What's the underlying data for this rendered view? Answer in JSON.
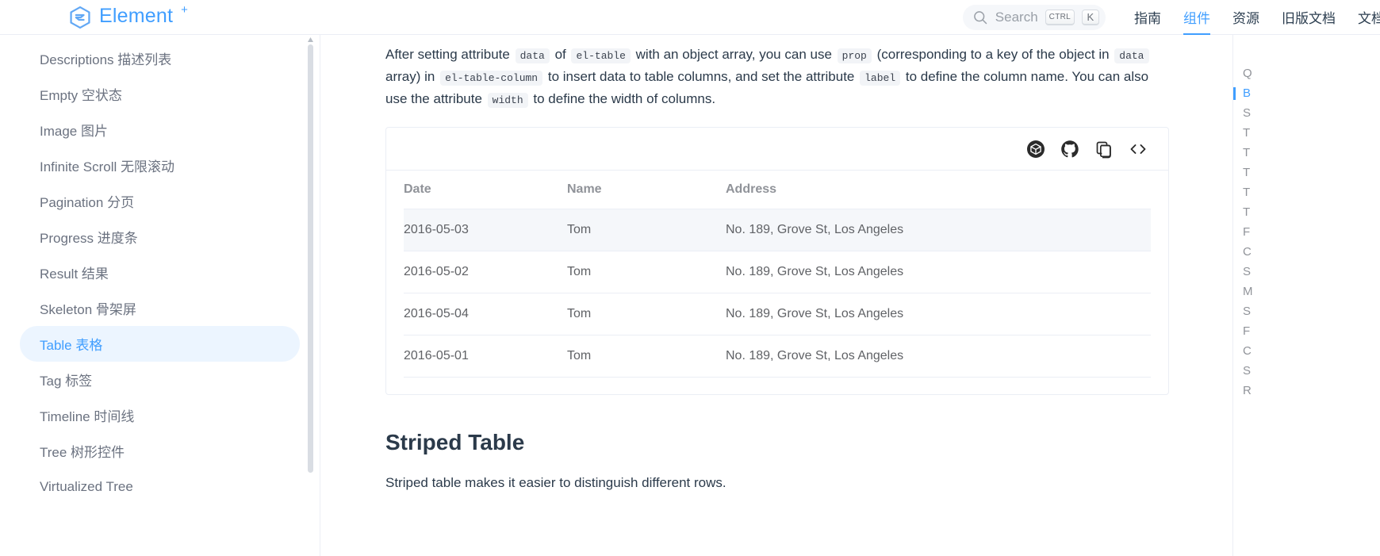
{
  "header": {
    "brand": {
      "name": "Element",
      "plus": "+",
      "logo_icon": "element-plus-logo"
    },
    "search": {
      "label": "Search",
      "icon": "search-icon",
      "kbd_ctrl": "CTRL",
      "kbd_key": "K"
    },
    "nav": [
      {
        "label": "指南",
        "active": false
      },
      {
        "label": "组件",
        "active": true
      },
      {
        "label": "资源",
        "active": false
      },
      {
        "label": "旧版文档",
        "active": false
      },
      {
        "label": "文档",
        "active": false
      }
    ]
  },
  "sidebar": {
    "items": [
      {
        "label": "Descriptions 描述列表",
        "active": false
      },
      {
        "label": "Empty 空状态",
        "active": false
      },
      {
        "label": "Image 图片",
        "active": false
      },
      {
        "label": "Infinite Scroll 无限滚动",
        "active": false
      },
      {
        "label": "Pagination 分页",
        "active": false
      },
      {
        "label": "Progress 进度条",
        "active": false
      },
      {
        "label": "Result 结果",
        "active": false
      },
      {
        "label": "Skeleton 骨架屏",
        "active": false
      },
      {
        "label": "Table 表格",
        "active": true
      },
      {
        "label": "Tag 标签",
        "active": false
      },
      {
        "label": "Timeline 时间线",
        "active": false
      },
      {
        "label": "Tree 树形控件",
        "active": false
      },
      {
        "label": "Virtualized Tree",
        "active": false
      }
    ]
  },
  "main": {
    "paragraph": {
      "t1": "After setting attribute",
      "c1": "data",
      "t2": "of",
      "c2": "el-table",
      "t3": "with an object array, you can use",
      "c3": "prop",
      "t4": "(corresponding to a key of the object in",
      "c4": "data",
      "t5": "array) in",
      "c5": "el-table-column",
      "t6": "to insert data to table columns, and set the attribute",
      "c6": "label",
      "t7": "to define the column name. You can also use the attribute",
      "c7": "width",
      "t8": "to define the width of columns."
    },
    "demo_actions": [
      {
        "icon": "codesandbox-icon",
        "title": "codesandbox"
      },
      {
        "icon": "github-icon",
        "title": "github"
      },
      {
        "icon": "copy-icon",
        "title": "copy"
      },
      {
        "icon": "code-brackets-icon",
        "title": "show-code"
      }
    ],
    "table": {
      "columns": [
        "Date",
        "Name",
        "Address"
      ],
      "rows": [
        {
          "date": "2016-05-03",
          "name": "Tom",
          "address": "No. 189, Grove St, Los Angeles",
          "hover": true
        },
        {
          "date": "2016-05-02",
          "name": "Tom",
          "address": "No. 189, Grove St, Los Angeles",
          "hover": false
        },
        {
          "date": "2016-05-04",
          "name": "Tom",
          "address": "No. 189, Grove St, Los Angeles",
          "hover": false
        },
        {
          "date": "2016-05-01",
          "name": "Tom",
          "address": "No. 189, Grove St, Los Angeles",
          "hover": false
        }
      ]
    },
    "striped_heading": "Striped Table",
    "striped_para": "Striped table makes it easier to distinguish different rows."
  },
  "toc": {
    "items": [
      {
        "label": "Q",
        "active": false
      },
      {
        "label": "B",
        "active": true
      },
      {
        "label": "S",
        "active": false
      },
      {
        "label": "T",
        "active": false
      },
      {
        "label": "T",
        "active": false
      },
      {
        "label": "T",
        "active": false
      },
      {
        "label": "T",
        "active": false
      },
      {
        "label": "T",
        "active": false
      },
      {
        "label": "F",
        "active": false
      },
      {
        "label": "C",
        "active": false
      },
      {
        "label": "S",
        "active": false
      },
      {
        "label": "M",
        "active": false
      },
      {
        "label": "S",
        "active": false
      },
      {
        "label": "F",
        "active": false
      },
      {
        "label": "C",
        "active": false
      },
      {
        "label": "S",
        "active": false
      },
      {
        "label": "R",
        "active": false
      }
    ]
  },
  "colors": {
    "brand": "#409eff",
    "active_bg": "#ecf5ff",
    "row_hover": "#f5f7fa",
    "border": "#ebeef5",
    "text": "#2b3a4a",
    "muted": "#909399"
  }
}
